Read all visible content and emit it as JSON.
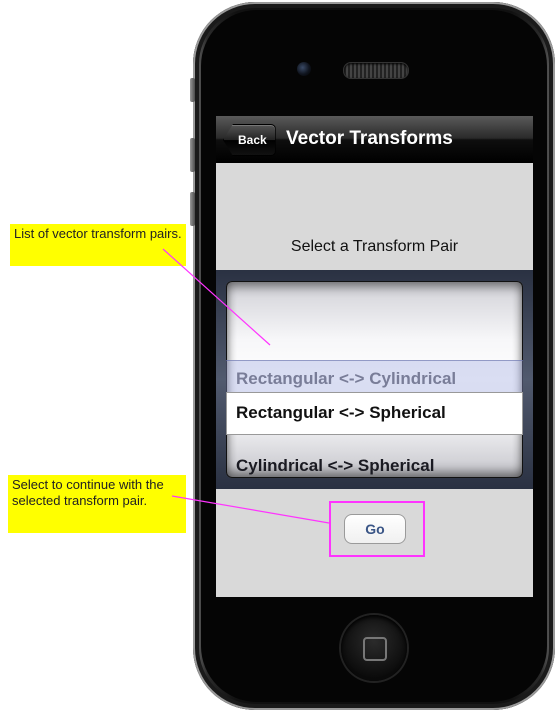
{
  "navbar": {
    "back_label": "Back",
    "title": "Vector Transforms"
  },
  "main": {
    "prompt": "Select a Transform Pair",
    "picker": {
      "options": [
        "Rectangular <-> Cylindrical",
        "Rectangular <-> Spherical",
        "Cylindrical <-> Spherical"
      ],
      "selected": "Rectangular <-> Spherical"
    },
    "go_label": "Go"
  },
  "annotations": {
    "note1": "List of vector transform pairs.",
    "note2": "Select to continue with the selected transform pair."
  },
  "colors": {
    "annotation_bg": "#ffff00",
    "annotation_line": "#ff33ff",
    "go_text": "#3a5586"
  }
}
